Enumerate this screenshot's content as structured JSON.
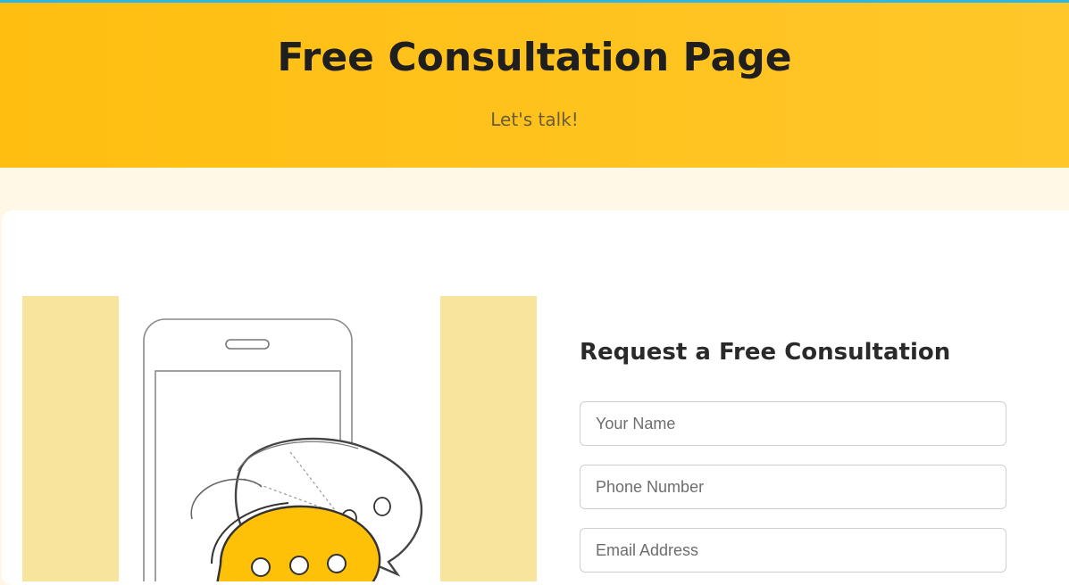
{
  "hero": {
    "title": "Free Consultation Page",
    "subtitle": "Let's talk!"
  },
  "form": {
    "title": "Request a Free Consultation",
    "fields": [
      {
        "name": "your-name",
        "placeholder": "Your Name",
        "value": ""
      },
      {
        "name": "phone-number",
        "placeholder": "Phone Number",
        "value": ""
      },
      {
        "name": "email-address",
        "placeholder": "Email Address",
        "value": ""
      }
    ]
  },
  "colors": {
    "hero_bg": "#ffbe10",
    "page_bg": "#fff8e6",
    "accent_band": "#f8e49c",
    "top_line": "#2bb6e6",
    "bubble_fill": "#ffc107"
  },
  "illustration": {
    "icon": "phone-chat-bubbles-icon"
  }
}
